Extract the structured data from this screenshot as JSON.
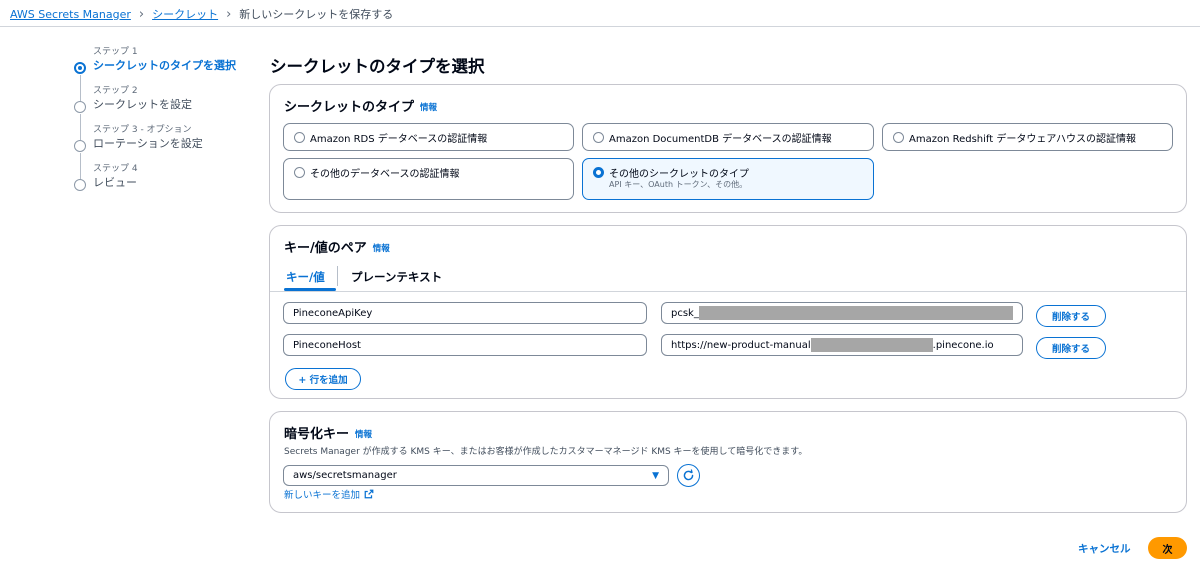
{
  "breadcrumb": {
    "items": [
      "AWS Secrets Manager",
      "シークレット"
    ],
    "current": "新しいシークレットを保存する"
  },
  "steps": [
    {
      "number": "ステップ 1",
      "title": "シークレットのタイプを選択",
      "active": true
    },
    {
      "number": "ステップ 2",
      "title": "シークレットを設定",
      "active": false
    },
    {
      "number": "ステップ 3 - オプション",
      "title": "ローテーションを設定",
      "active": false
    },
    {
      "number": "ステップ 4",
      "title": "レビュー",
      "active": false
    }
  ],
  "page_title": "シークレットのタイプを選択",
  "secret_type": {
    "title": "シークレットのタイプ",
    "info": "情報",
    "options": [
      {
        "label": "Amazon RDS データベースの認証情報",
        "desc": ""
      },
      {
        "label": "Amazon DocumentDB データベースの認証情報",
        "desc": ""
      },
      {
        "label": "Amazon Redshift データウェアハウスの認証情報",
        "desc": ""
      },
      {
        "label": "その他のデータベースの認証情報",
        "desc": ""
      },
      {
        "label": "その他のシークレットのタイプ",
        "desc": "API キー、OAuth トークン、その他。"
      }
    ],
    "selected_index": 4
  },
  "kv": {
    "title": "キー/値のペア",
    "info": "情報",
    "tabs": [
      "キー/値",
      "プレーンテキスト"
    ],
    "active_tab": 0,
    "rows": [
      {
        "key": "PineconeApiKey",
        "value_prefix": "pcsk_",
        "value_suffix": "",
        "remove": "削除する"
      },
      {
        "key": "PineconeHost",
        "value_prefix": "https://new-product-manual",
        "value_suffix": ".pinecone.io",
        "remove": "削除する"
      }
    ],
    "add_row": "+ 行を追加"
  },
  "encryption": {
    "title": "暗号化キー",
    "info": "情報",
    "description": "Secrets Manager が作成する KMS キー、またはお客様が作成したカスタマーマネージド KMS キーを使用して暗号化できます。",
    "selected": "aws/secretsmanager",
    "new_key": "新しいキーを追加"
  },
  "footer": {
    "cancel": "キャンセル",
    "next": "次"
  },
  "colors": {
    "link": "#0972d3",
    "primary_button": "#ff9900",
    "text": "#000716"
  }
}
